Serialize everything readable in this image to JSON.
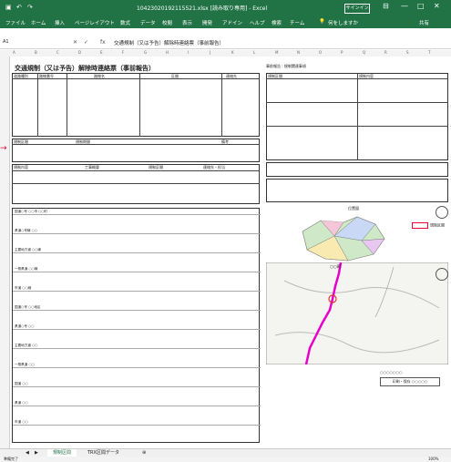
{
  "window": {
    "title": "10423020192115521.xlsx [読み取り専用] - Excel",
    "signin": "サインイン",
    "share_label": "共有"
  },
  "ribbon": {
    "tabs": [
      "ファイル",
      "ホーム",
      "挿入",
      "ページレイアウト",
      "数式",
      "データ",
      "校閲",
      "表示",
      "開発",
      "アドイン",
      "ヘルプ",
      "検索",
      "チーム",
      "操作アシスト"
    ],
    "tellme": "何をしますか"
  },
  "formula_bar": {
    "name_box": "A1",
    "fx": "fx",
    "content": "交通規制（又は予告）解除時連絡票（事前報告）"
  },
  "columns": [
    "A",
    "B",
    "C",
    "D",
    "E",
    "F",
    "G",
    "H",
    "I",
    "J",
    "K",
    "L",
    "M",
    "N",
    "O",
    "P",
    "Q",
    "R",
    "S",
    "T"
  ],
  "document": {
    "title": "交通規制（又は予告）解除時連絡票（事前報告）",
    "headers": [
      "道路種別",
      "路線番号",
      "路線名",
      "区間",
      "連絡先",
      "規制区間",
      "規制期間",
      "備考"
    ],
    "section_headers": [
      "規制内容",
      "工事概要",
      "規制区間",
      "連絡先・担当",
      "規制の種類",
      "迂回路"
    ],
    "office_label": "事務所",
    "row_labels": [
      "1",
      "2",
      "3",
      "4",
      "5",
      "6",
      "7",
      "8",
      "9"
    ],
    "list_rows": [
      "国道○号 ○○市 ○○町",
      "県道○号線 ○○",
      "主要地方道 ○○線",
      "一般県道 ○○線",
      "市道 ○○線",
      "国道○号 ○○地区",
      "県道○号 ○○",
      "主要地方道 ○○",
      "一般県道 ○○",
      "国道 ○○",
      "県道 ○○",
      "市道 ○○"
    ]
  },
  "right_panel": {
    "top_label": "事前報告 : 規制関連事項",
    "sections": [
      "規制区間",
      "規制内容",
      "位置図"
    ],
    "legend_label": "規制区間",
    "map_place": "○○町",
    "footer_note": "○○○○○○○",
    "footer_button": "印刷・保存 ○○○○○"
  },
  "sheet_tabs": [
    "規制区間",
    "TRX区間データ"
  ],
  "status": {
    "ready": "準備完了",
    "zoom": "100%"
  },
  "colors": {
    "excel_green": "#217346",
    "route_magenta": "#e600c8",
    "accent_red": "#e03333"
  }
}
